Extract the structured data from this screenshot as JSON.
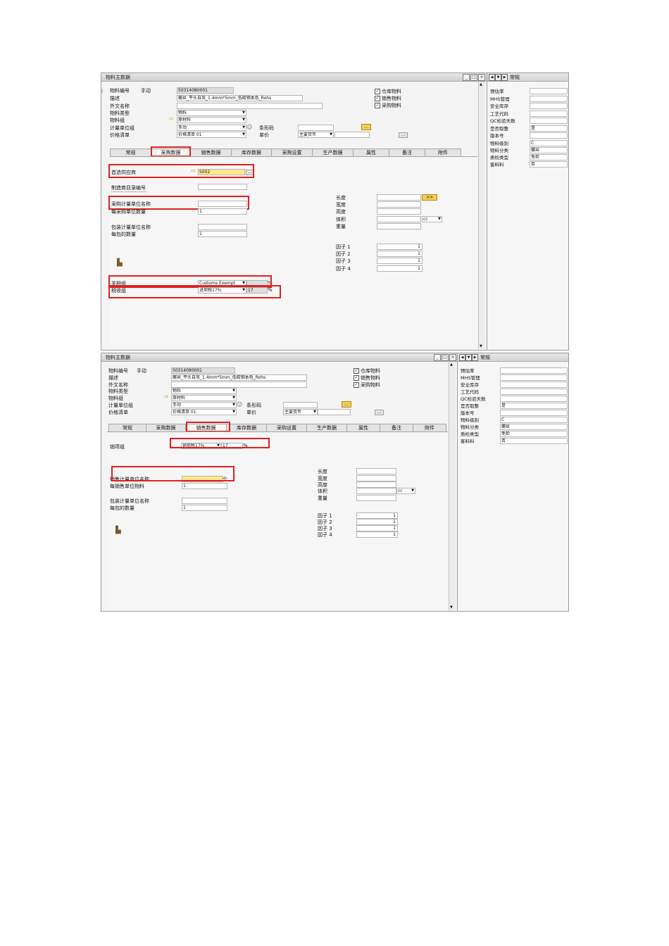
{
  "shot1": {
    "window_title": "物料主数据",
    "item_no_label": "物料编号",
    "item_no_mode": "手动",
    "item_no_value": "50314080001",
    "desc_label": "描述",
    "desc_value": "螺丝_平头自攻_1.4mm*5mm_低碳钢本色_Rohs",
    "foreign_label": "外文名称",
    "type_label": "物料类型",
    "type_value": "物料",
    "group_label": "物料组",
    "group_value": "原材料",
    "uom_group_label": "计量单位组",
    "uom_group_value": "手动",
    "price_list_label": "价格清单",
    "price_list_value": "价格清单 01",
    "barcode_label": "条形码",
    "unit_price_label": "单价",
    "currency_value": "主要货币",
    "chk_inventory": "仓库物料",
    "chk_sales": "销售物料",
    "chk_purchase": "采购物料",
    "tabs": [
      "常规",
      "采购数据",
      "销售数据",
      "库存数据",
      "采购设置",
      "生产数据",
      "属性",
      "备注",
      "附件"
    ],
    "pref_vendor_label": "首选供应商",
    "pref_vendor_value": "S002",
    "mfr_catalog_label": "制造商目录编号",
    "purch_uom_label": "采购计量单位名称",
    "items_per_purch_label": "每采购单位数量",
    "items_per_purch_value": "1",
    "pack_uom_label": "包装计量单位名称",
    "qty_per_pack_label": "每包的数量",
    "qty_per_pack_value": "1",
    "length_label": "长度",
    "width_label": "宽度",
    "height_label": "高度",
    "volume_label": "体积",
    "volume_unit": "cc",
    "weight_label": "重量",
    "factor1_label": "因子 1",
    "factor2_label": "因子 2",
    "factor3_label": "因子 3",
    "factor4_label": "因子 4",
    "factor_value": "1",
    "expand_btn": ">>",
    "customs_label": "关税组",
    "customs_value": "Customs Exempt",
    "customs_pct": "%",
    "tax_label": "税收组",
    "tax_value": "进项税17%",
    "tax_rate": "17",
    "tax_pct": "%"
  },
  "shot2": {
    "window_title": "物料主数据",
    "item_no_label": "物料编号",
    "item_no_mode": "手动",
    "item_no_value": "50314080001",
    "desc_label": "描述",
    "desc_value": "螺丝_平头自攻_1.4mm*5mm_低碳钢本色_Rohs",
    "foreign_label": "外文名称",
    "type_label": "物料类型",
    "type_value": "物料",
    "group_label": "物料组",
    "group_value": "原材料",
    "uom_group_label": "计量单位组",
    "uom_group_value": "手动",
    "price_list_label": "价格清单",
    "price_list_value": "价格清单 01",
    "barcode_label": "条形码",
    "unit_price_label": "单价",
    "currency_value": "主要货币",
    "chk_inventory": "仓库物料",
    "chk_sales": "销售物料",
    "chk_purchase": "采购物料",
    "tabs": [
      "常规",
      "采购数据",
      "销售数据",
      "库存数据",
      "采购设置",
      "生产数据",
      "属性",
      "备注",
      "附件"
    ],
    "tax_label": "销项组",
    "tax_value": "销项税17%",
    "tax_rate": "17",
    "tax_pct": "%",
    "sales_uom_label": "销售计量单位名称",
    "sales_uom_value": "个",
    "items_per_sales_label": "每销售单位物料",
    "items_per_sales_value": "1",
    "pack_uom_label": "包装计量单位名称",
    "qty_per_pack_label": "每包的数量",
    "qty_per_pack_value": "1",
    "length_label": "长度",
    "width_label": "宽度",
    "height_label": "高度",
    "volume_label": "体积",
    "volume_unit": "cc",
    "weight_label": "重量",
    "factor1_label": "因子 1",
    "factor2_label": "因子 2",
    "factor3_label": "因子 3",
    "factor4_label": "因子 4",
    "factor_value": "1"
  },
  "sidebar": {
    "header": "常规",
    "rows": [
      {
        "k": "预估率",
        "v": ""
      },
      {
        "k": "MHS管理",
        "v": ""
      },
      {
        "k": "安全库存",
        "v": ""
      },
      {
        "k": "工艺代码",
        "v": ""
      },
      {
        "k": "QC检验天数",
        "v": ""
      },
      {
        "k": "是否取整",
        "v": "是"
      },
      {
        "k": "版本号",
        "v": ""
      },
      {
        "k": "物料级别",
        "v": "C"
      },
      {
        "k": "物料分类",
        "v": "螺丝"
      },
      {
        "k": "质检类型",
        "v": "免检"
      },
      {
        "k": "客料料",
        "v": "否"
      }
    ]
  },
  "colors": {
    "highlight_red": "#e02020",
    "yellow_field": "#ffe98a",
    "button_yellow": "#f4cf57"
  }
}
